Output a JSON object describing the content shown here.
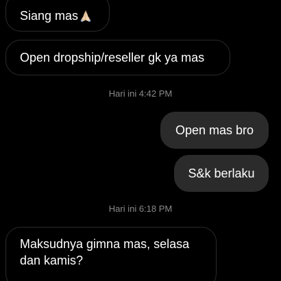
{
  "messages": [
    {
      "direction": "received",
      "text": "Siang mas",
      "emoji": "folded-hands-icon"
    },
    {
      "direction": "received",
      "text": "Open dropship/reseller gk ya mas"
    },
    {
      "type": "timestamp",
      "text": "Hari ini 4:42 PM"
    },
    {
      "direction": "sent",
      "text": "Open mas bro"
    },
    {
      "direction": "sent",
      "text": "S&k berlaku"
    },
    {
      "type": "timestamp",
      "text": "Hari ini 6:18 PM"
    },
    {
      "direction": "received",
      "text": "Maksudnya gimna mas, selasa dan kamis?"
    }
  ],
  "colors": {
    "background": "#000000",
    "sent_bubble": "#2b2b2b",
    "received_border": "#2a2a2a",
    "timestamp_text": "#8a8a8a",
    "message_text": "#ffffff"
  }
}
